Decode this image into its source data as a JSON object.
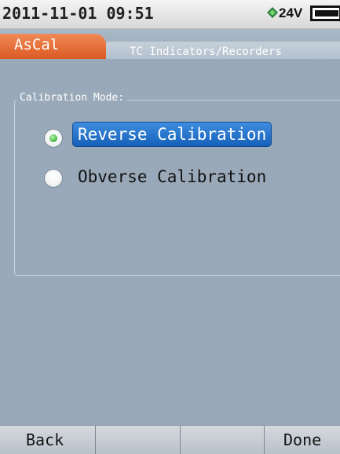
{
  "status_bar": {
    "datetime": "2011-11-01 09:51",
    "voltage": "24V",
    "icons": [
      "power-supply-icon",
      "battery-icon"
    ]
  },
  "tabs": {
    "active": "AsCal",
    "secondary": "TC Indicators/Recorders"
  },
  "calibration_mode": {
    "legend": "Calibration Mode:",
    "options": [
      {
        "label": "Reverse Calibration",
        "selected": true
      },
      {
        "label": "Obverse Calibration",
        "selected": false
      }
    ]
  },
  "softkeys": {
    "left": "Back",
    "middle_1": "",
    "middle_2": "",
    "right": "Done"
  },
  "colors": {
    "background": "#9aa9b9",
    "tab_active": "#e9703b",
    "selection": "#2a78d0",
    "radio_selected": "#3cb436"
  }
}
